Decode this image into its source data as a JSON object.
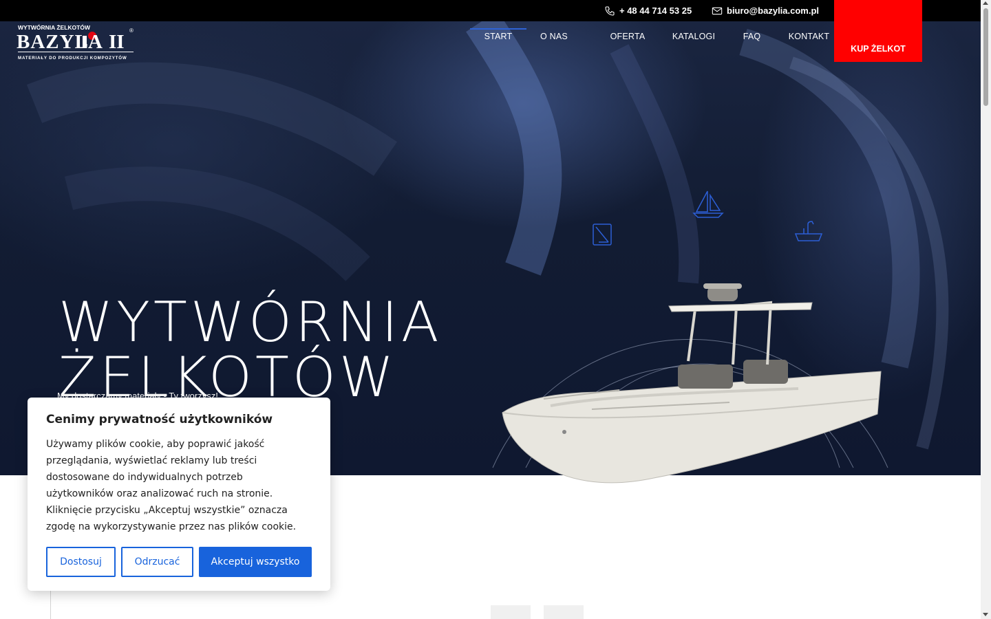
{
  "topbar": {
    "phone": "+ 48 44 714 53 25",
    "email": "biuro@bazylia.com.pl",
    "phone_icon": "phone-icon",
    "email_icon": "envelope-icon"
  },
  "logo": {
    "top_text": "WYTWÓRNIA ŻELKOTÓW",
    "name": "BAZYLIA II",
    "tagline": "MATERIAŁY DO PRODUKCJI KOMPOZYTÓW",
    "registered": "®"
  },
  "nav": {
    "items": [
      {
        "label": "START",
        "active": true
      },
      {
        "label": "O NAS"
      },
      {
        "label": "OFERTA"
      },
      {
        "label": "KATALOGI"
      },
      {
        "label": "FAQ"
      },
      {
        "label": "KONTAKT"
      }
    ],
    "cta": "KUP ŻELKOT"
  },
  "hero": {
    "title_line1": "WYTWÓRNIA",
    "title_line2": "ŻELKOTÓW",
    "subtitle": "My dostarczamy materiały - Ty tworzysz!",
    "icons": [
      "sailboat-icon",
      "panel-icon",
      "sink-icon",
      "motorboat-illustration"
    ]
  },
  "cookie": {
    "title": "Cenimy prywatność użytkowników",
    "text": "Używamy plików cookie, aby poprawić jakość przeglądania, wyświetlać reklamy lub treści dostosowane do indywidualnych potrzeb użytkowników oraz analizować ruch na stronie. Kliknięcie przycisku „Akceptuj wszystkie” oznacza zgodę na wykorzystywanie przez nas plików cookie.",
    "btn_customize": "Dostosuj",
    "btn_reject": "Odrzucać",
    "btn_accept": "Akceptuj wszystko"
  },
  "colors": {
    "accent": "#1863dc",
    "cta": "#ff0000",
    "nav_active": "#2e63d6",
    "topbar": "#000000",
    "hero_bg": "#121c33"
  }
}
